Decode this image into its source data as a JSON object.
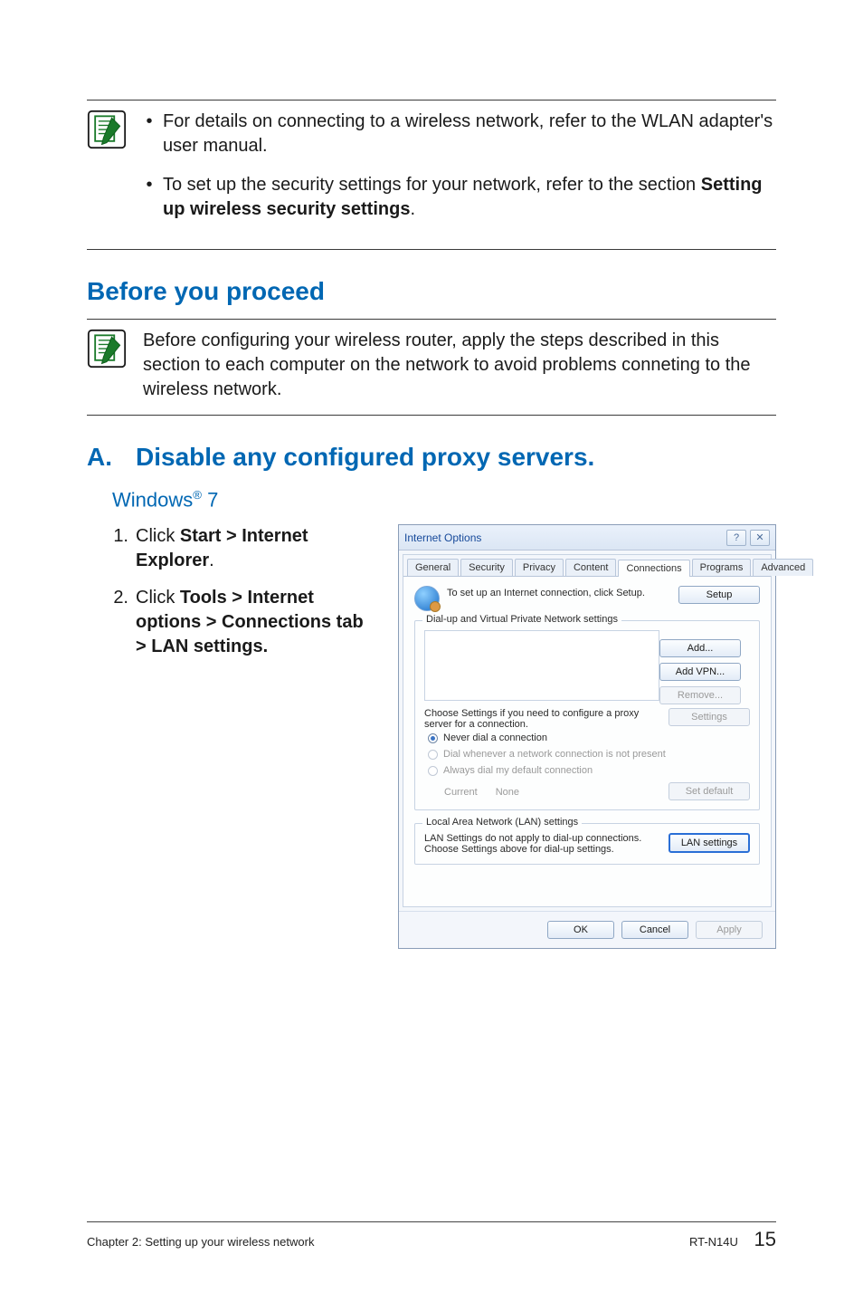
{
  "notes": {
    "item1": "For details on connecting to a wireless network, refer to the WLAN adapter's user manual.",
    "item2_pre": "To set up the security settings for your network, refer to the section ",
    "item2_bold": "Setting up wireless security settings",
    "item2_post": "."
  },
  "sections": {
    "before_title": "Before you proceed",
    "before_body": "Before configuring your wireless router, apply the steps described in this section to each computer on the network to avoid problems conneting to the wireless network.",
    "a_letter": "A.",
    "a_title": "Disable any configured proxy servers.",
    "win_label_pre": "Windows",
    "win_label_post": " 7"
  },
  "steps": {
    "s1_pre": "Click ",
    "s1_bold": "Start > Internet Explorer",
    "s1_post": ".",
    "s2_pre": "Click ",
    "s2_bold": "Tools > Internet options > Connections tab > LAN settings."
  },
  "dialog": {
    "title": "Internet Options",
    "tabs": {
      "general": "General",
      "security": "Security",
      "privacy": "Privacy",
      "content": "Content",
      "connections": "Connections",
      "programs": "Programs",
      "advanced": "Advanced"
    },
    "setup_desc": "To set up an Internet connection, click Setup.",
    "setup_btn": "Setup",
    "dialup_legend": "Dial-up and Virtual Private Network settings",
    "add_btn": "Add...",
    "addvpn_btn": "Add VPN...",
    "remove_btn": "Remove...",
    "proxy_desc": "Choose Settings if you need to configure a proxy server for a connection.",
    "settings_btn": "Settings",
    "radio_never": "Never dial a connection",
    "radio_whenever": "Dial whenever a network connection is not present",
    "radio_always": "Always dial my default connection",
    "current_label": "Current",
    "current_value": "None",
    "setdefault_btn": "Set default",
    "lan_legend": "Local Area Network (LAN) settings",
    "lan_desc": "LAN Settings do not apply to dial-up connections. Choose Settings above for dial-up settings.",
    "lan_btn": "LAN settings",
    "ok": "OK",
    "cancel": "Cancel",
    "apply": "Apply"
  },
  "footer": {
    "chapter": "Chapter 2: Setting up your wireless network",
    "model": "RT-N14U",
    "page": "15"
  }
}
